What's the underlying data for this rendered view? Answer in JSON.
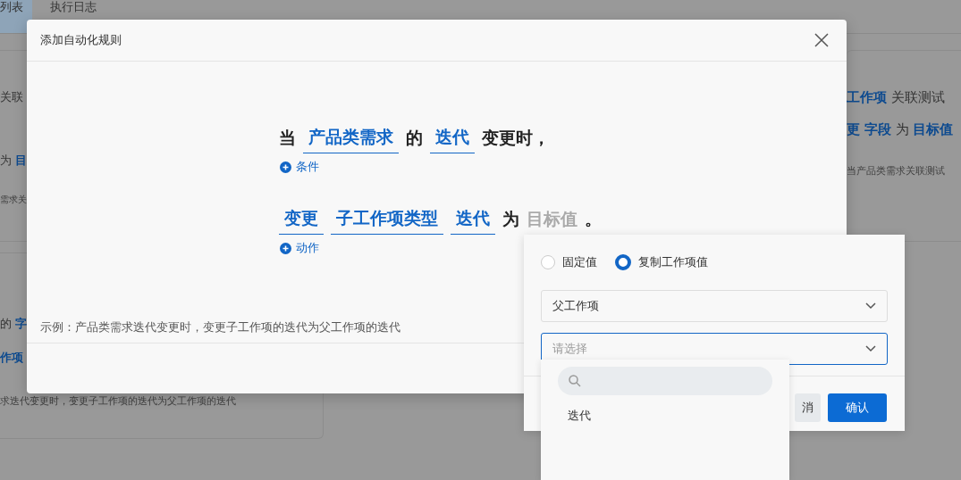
{
  "background_page": {
    "tabs": [
      {
        "label": "列表",
        "selected": true
      },
      {
        "label": "执行日志",
        "selected": false
      }
    ],
    "left_cards": [
      {
        "lines": [
          {
            "kind": "rule",
            "text": "关联"
          },
          {
            "kind": "rule",
            "text": "为 **目**"
          },
          {
            "kind": "desc",
            "text": "需求关"
          }
        ]
      },
      {
        "lines": [
          {
            "kind": "rule",
            "text": "的 **字**"
          },
          {
            "kind": "rule",
            "text": "**作项**"
          },
          {
            "kind": "desc",
            "text": "求迭代变更时，变更子工作项的迭代为父工作项的迭代"
          }
        ]
      }
    ],
    "right_cards": [
      {
        "lines": [
          {
            "kind": "rule",
            "text": "**工作项** 关联测试"
          },
          {
            "kind": "rule",
            "text": "**更** **字段** 为 **目标值**"
          },
          {
            "kind": "desc",
            "text": "当产品类需求关联测试"
          }
        ]
      }
    ]
  },
  "modal": {
    "title": "添加自动化规则",
    "rows": [
      {
        "parts": [
          {
            "kind": "text",
            "text": "当"
          },
          {
            "kind": "field",
            "text": "产品类需求"
          },
          {
            "kind": "text",
            "text": "的"
          },
          {
            "kind": "field",
            "text": "迭代"
          },
          {
            "kind": "text",
            "text": "变更时，"
          }
        ],
        "add": "条件"
      },
      {
        "parts": [
          {
            "kind": "field",
            "text": "变更"
          },
          {
            "kind": "field",
            "text": "子工作项类型"
          },
          {
            "kind": "field",
            "text": "迭代"
          },
          {
            "kind": "text",
            "text": "为"
          },
          {
            "kind": "placeholder",
            "text": "目标值"
          },
          {
            "kind": "text",
            "text": "。"
          }
        ],
        "add": "动作"
      }
    ],
    "hint": "示例：产品类需求迭代变更时，变更子工作项的迭代为父工作项的迭代"
  },
  "popover": {
    "radios": [
      {
        "label": "固定值",
        "selected": false
      },
      {
        "label": "复制工作项值",
        "selected": true
      }
    ],
    "selects": [
      {
        "value": "父工作项",
        "focused": false
      },
      {
        "placeholder": "请选择",
        "focused": true
      }
    ],
    "buttons": [
      {
        "label": "消",
        "kind": "secondary"
      },
      {
        "label": "确认",
        "kind": "primary"
      }
    ]
  },
  "dropdown": {
    "options": [
      "迭代"
    ]
  }
}
